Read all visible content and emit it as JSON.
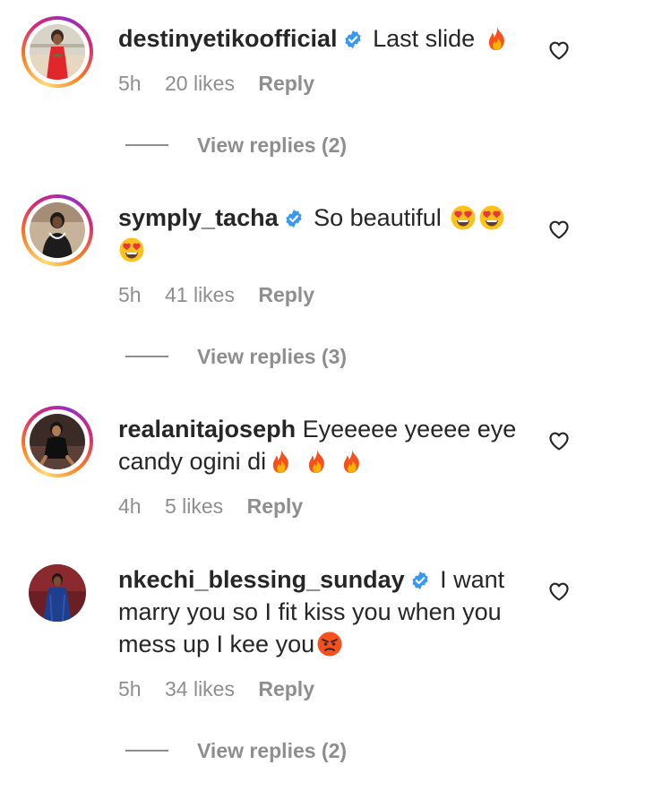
{
  "comments": [
    {
      "username": "destinyetikoofficial",
      "text": "Last slide",
      "time": "5h",
      "likes": "20 likes",
      "reply": "Reply",
      "view_replies": "View replies (2)"
    },
    {
      "username": "symply_tacha",
      "text": "So beautiful",
      "time": "5h",
      "likes": "41 likes",
      "reply": "Reply",
      "view_replies": "View replies (3)"
    },
    {
      "username": "realanitajoseph",
      "text": "Eyeeeee yeeee eye candy ogini di",
      "time": "4h",
      "likes": "5 likes",
      "reply": "Reply"
    },
    {
      "username": "nkechi_blessing_sunday",
      "text": "I want marry you so I fit kiss you when you mess up I kee you",
      "time": "5h",
      "likes": "34 likes",
      "reply": "Reply",
      "view_replies": "View replies (2)"
    }
  ],
  "colors": {
    "verified": "#3897f0",
    "secondary_text": "#8e8e8e",
    "primary_text": "#262626"
  },
  "icons": {
    "verified": "verified-badge-icon",
    "like": "heart-outline-icon",
    "fire": "fire-emoji",
    "heart_eyes": "heart-eyes-emoji",
    "angry": "angry-face-emoji"
  }
}
